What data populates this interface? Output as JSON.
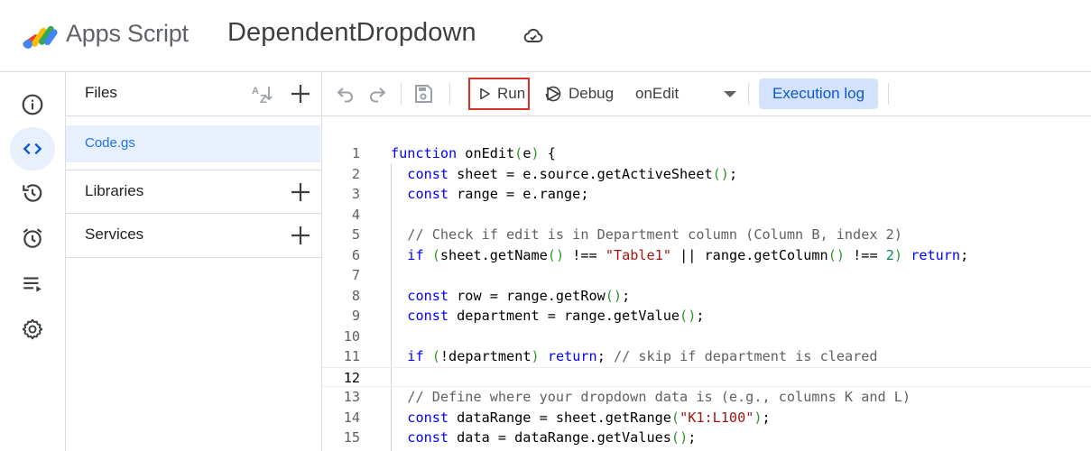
{
  "header": {
    "app_name": "Apps Script",
    "project_name": "DependentDropdown"
  },
  "rail": {
    "items": [
      {
        "name": "overview",
        "icon": "info-icon"
      },
      {
        "name": "editor",
        "icon": "code-icon",
        "active": true
      },
      {
        "name": "history",
        "icon": "history-icon"
      },
      {
        "name": "triggers",
        "icon": "alarm-icon"
      },
      {
        "name": "executions",
        "icon": "executions-icon"
      },
      {
        "name": "settings",
        "icon": "gear-icon"
      }
    ]
  },
  "files_panel": {
    "files_label": "Files",
    "files": [
      {
        "name": "Code.gs",
        "selected": true
      }
    ],
    "libraries_label": "Libraries",
    "services_label": "Services"
  },
  "toolbar": {
    "run_label": "Run",
    "debug_label": "Debug",
    "function_selected": "onEdit",
    "execution_log_label": "Execution log"
  },
  "editor": {
    "current_line": 12,
    "lines": [
      {
        "n": "1",
        "text": "function onEdit(e) {"
      },
      {
        "n": "2",
        "text": "  const sheet = e.source.getActiveSheet();"
      },
      {
        "n": "3",
        "text": "  const range = e.range;"
      },
      {
        "n": "4",
        "text": ""
      },
      {
        "n": "5",
        "text": "  // Check if edit is in Department column (Column B, index 2)"
      },
      {
        "n": "6",
        "text": "  if (sheet.getName() !== \"Table1\" || range.getColumn() !== 2) return;"
      },
      {
        "n": "7",
        "text": ""
      },
      {
        "n": "8",
        "text": "  const row = range.getRow();"
      },
      {
        "n": "9",
        "text": "  const department = range.getValue();"
      },
      {
        "n": "10",
        "text": ""
      },
      {
        "n": "11",
        "text": "  if (!department) return; // skip if department is cleared"
      },
      {
        "n": "12",
        "text": ""
      },
      {
        "n": "13",
        "text": "  // Define where your dropdown data is (e.g., columns K and L)"
      },
      {
        "n": "14",
        "text": "  const dataRange = sheet.getRange(\"K1:L100\");"
      },
      {
        "n": "15",
        "text": "  const data = dataRange.getValues();"
      }
    ]
  },
  "colors": {
    "accent": "#1a73e8",
    "selection_bg": "#e8f0fe",
    "run_highlight": "#d93025",
    "exec_log_bg": "#d3e3fd"
  }
}
